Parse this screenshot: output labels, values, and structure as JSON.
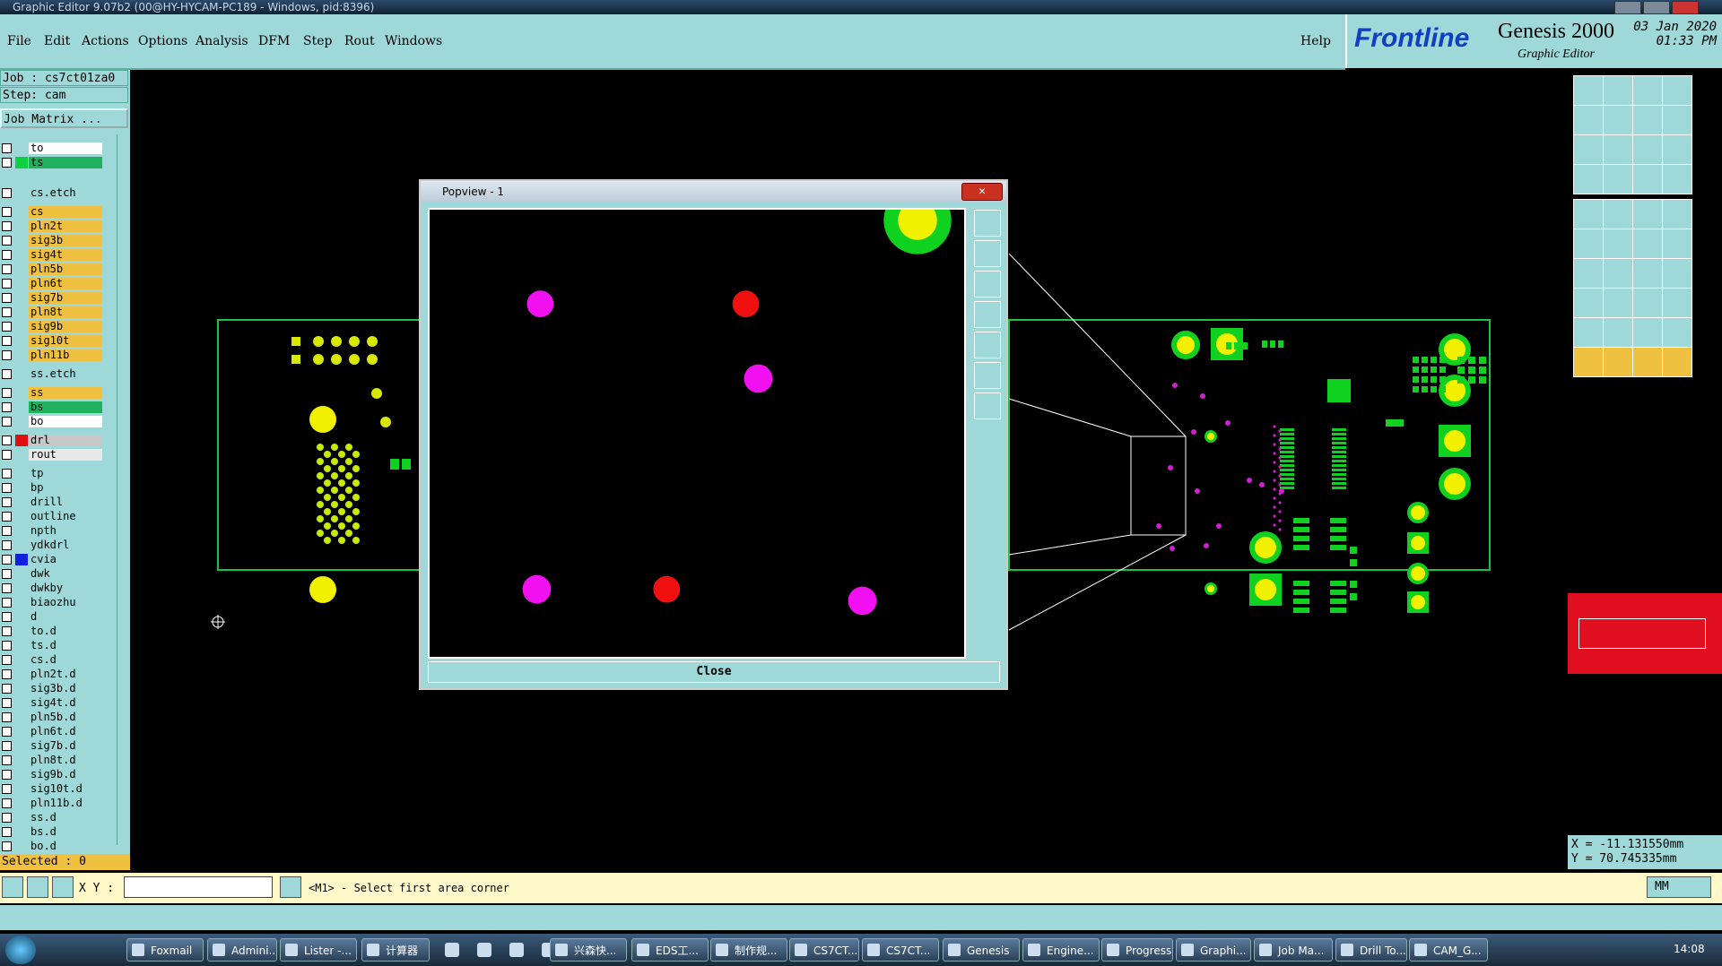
{
  "window": {
    "title": "Graphic Editor 9.07b2 (00@HY-HYCAM-PC189 - Windows, pid:8396)"
  },
  "menu": [
    "File",
    "Edit",
    "Actions",
    "Options",
    "Analysis",
    "DFM",
    "Step",
    "Rout",
    "Windows"
  ],
  "help": "Help",
  "brand": {
    "logo": "Frontline",
    "product": "Genesis 2000",
    "subtitle": "Graphic Editor",
    "date": "03 Jan 2020",
    "time": "01:33 PM"
  },
  "job": {
    "job_line": "Job : cs7ct01za0",
    "step_line": "Step: cam",
    "matrix_button": "Job Matrix ..."
  },
  "layers": [
    {
      "name": "to",
      "color": "#ffffff",
      "swatch": ""
    },
    {
      "name": "ts",
      "color": "#20b060",
      "swatch": "#10d040"
    },
    {
      "name": "cs.etch",
      "color": "#9fd8d8",
      "swatch": ""
    },
    {
      "name": "cs",
      "color": "#f0c040",
      "swatch": ""
    },
    {
      "name": "pln2t",
      "color": "#f0c040",
      "swatch": ""
    },
    {
      "name": "sig3b",
      "color": "#f0c040",
      "swatch": ""
    },
    {
      "name": "sig4t",
      "color": "#f0c040",
      "swatch": ""
    },
    {
      "name": "pln5b",
      "color": "#f0c040",
      "swatch": ""
    },
    {
      "name": "pln6t",
      "color": "#f0c040",
      "swatch": ""
    },
    {
      "name": "sig7b",
      "color": "#f0c040",
      "swatch": ""
    },
    {
      "name": "pln8t",
      "color": "#f0c040",
      "swatch": ""
    },
    {
      "name": "sig9b",
      "color": "#f0c040",
      "swatch": ""
    },
    {
      "name": "sig10t",
      "color": "#f0c040",
      "swatch": ""
    },
    {
      "name": "pln11b",
      "color": "#f0c040",
      "swatch": ""
    },
    {
      "name": "ss.etch",
      "color": "#9fd8d8",
      "swatch": ""
    },
    {
      "name": "ss",
      "color": "#f0c040",
      "swatch": ""
    },
    {
      "name": "bs",
      "color": "#20b060",
      "swatch": ""
    },
    {
      "name": "bo",
      "color": "#ffffff",
      "swatch": ""
    },
    {
      "name": "drl",
      "color": "#c8c8c8",
      "swatch": "#e01010"
    },
    {
      "name": "rout",
      "color": "#e8e8e8",
      "swatch": ""
    },
    {
      "name": "tp",
      "color": "#9fd8d8",
      "swatch": ""
    },
    {
      "name": "bp",
      "color": "#9fd8d8",
      "swatch": ""
    },
    {
      "name": "drill",
      "color": "#9fd8d8",
      "swatch": ""
    },
    {
      "name": "outline",
      "color": "#9fd8d8",
      "swatch": ""
    },
    {
      "name": "npth",
      "color": "#9fd8d8",
      "swatch": ""
    },
    {
      "name": "ydkdrl",
      "color": "#9fd8d8",
      "swatch": ""
    },
    {
      "name": "cvia",
      "color": "#9fd8d8",
      "swatch": "#1020e0"
    },
    {
      "name": "dwk",
      "color": "#9fd8d8",
      "swatch": ""
    },
    {
      "name": "dwkby",
      "color": "#9fd8d8",
      "swatch": ""
    },
    {
      "name": "biaozhu",
      "color": "#9fd8d8",
      "swatch": ""
    },
    {
      "name": "d",
      "color": "#9fd8d8",
      "swatch": ""
    },
    {
      "name": "to.d",
      "color": "#9fd8d8",
      "swatch": ""
    },
    {
      "name": "ts.d",
      "color": "#9fd8d8",
      "swatch": ""
    },
    {
      "name": "cs.d",
      "color": "#9fd8d8",
      "swatch": ""
    },
    {
      "name": "pln2t.d",
      "color": "#9fd8d8",
      "swatch": ""
    },
    {
      "name": "sig3b.d",
      "color": "#9fd8d8",
      "swatch": ""
    },
    {
      "name": "sig4t.d",
      "color": "#9fd8d8",
      "swatch": ""
    },
    {
      "name": "pln5b.d",
      "color": "#9fd8d8",
      "swatch": ""
    },
    {
      "name": "pln6t.d",
      "color": "#9fd8d8",
      "swatch": ""
    },
    {
      "name": "sig7b.d",
      "color": "#9fd8d8",
      "swatch": ""
    },
    {
      "name": "pln8t.d",
      "color": "#9fd8d8",
      "swatch": ""
    },
    {
      "name": "sig9b.d",
      "color": "#9fd8d8",
      "swatch": ""
    },
    {
      "name": "sig10t.d",
      "color": "#9fd8d8",
      "swatch": ""
    },
    {
      "name": "pln11b.d",
      "color": "#9fd8d8",
      "swatch": ""
    },
    {
      "name": "ss.d",
      "color": "#9fd8d8",
      "swatch": ""
    },
    {
      "name": "bs.d",
      "color": "#9fd8d8",
      "swatch": ""
    },
    {
      "name": "bo.d",
      "color": "#9fd8d8",
      "swatch": ""
    }
  ],
  "selected": "Selected : 0",
  "popview": {
    "title": "Popview - 1",
    "close_x": "✕",
    "close_button": "Close"
  },
  "coords": {
    "x": "X = -11.131550mm",
    "y": "Y = 70.745335mm"
  },
  "status": {
    "xy_label": "X Y :",
    "xy_value": "",
    "prompt": "<M1> - Select first area corner",
    "units": "MM"
  },
  "taskbar": [
    {
      "label": "Foxmail"
    },
    {
      "label": "Admini..."
    },
    {
      "label": "Lister -..."
    },
    {
      "label": "计算器"
    },
    {
      "label": "兴森快..."
    },
    {
      "label": "EDS工..."
    },
    {
      "label": "制作规..."
    },
    {
      "label": "CS7CT..."
    },
    {
      "label": "CS7CT..."
    },
    {
      "label": "Genesis"
    },
    {
      "label": "Engine..."
    },
    {
      "label": "Progress"
    },
    {
      "label": "Graphi..."
    },
    {
      "label": "Job Ma..."
    },
    {
      "label": "Drill To..."
    },
    {
      "label": "CAM_G..."
    }
  ],
  "clock": "14:08",
  "colors": {
    "panel": "#9fd8d8",
    "board_outline": "#20c040",
    "pad_yellow": "#f0f000",
    "pad_green": "#10d020",
    "via_magenta": "#f010f0",
    "drill_red": "#f01010"
  }
}
